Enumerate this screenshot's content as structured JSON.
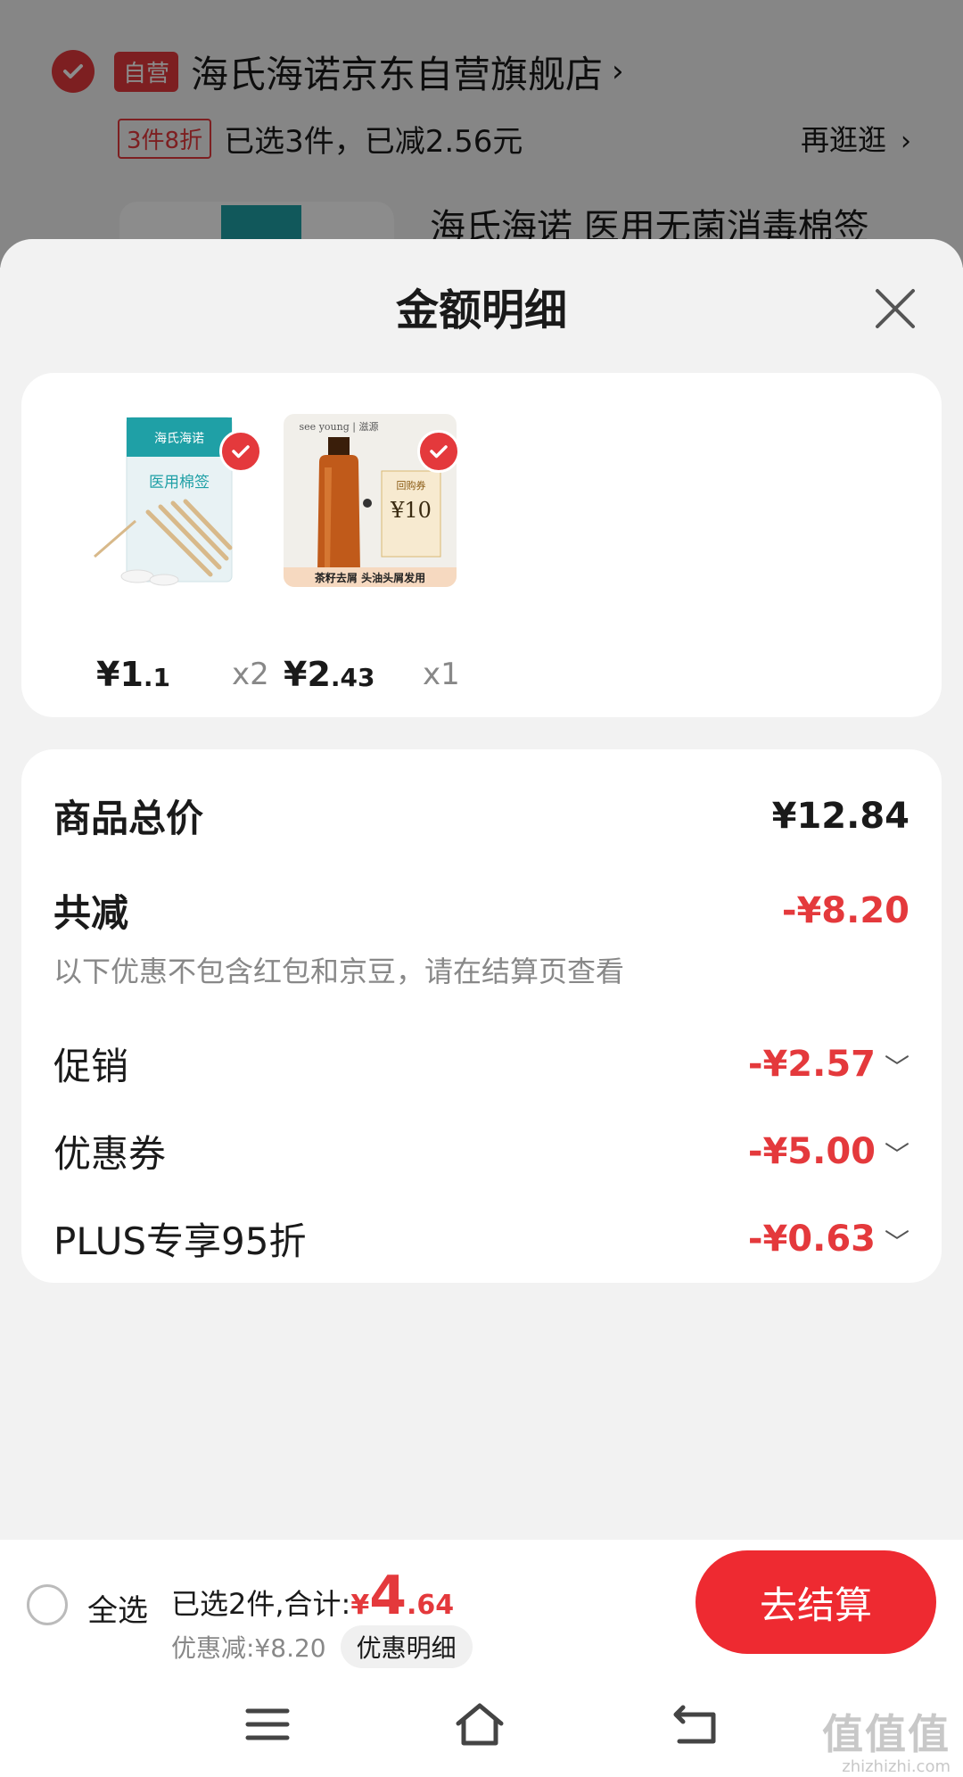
{
  "background_cart": {
    "self_tag": "自营",
    "store_name": "海氏海诺京东自营旗舰店",
    "store_chevron": "›",
    "promo_tag": "3件8折",
    "promo_text": "已选3件，已减2.56元",
    "browse_label": "再逛逛",
    "browse_chevron": "›",
    "product_title": "海氏海诺 医用无菌消毒棉签"
  },
  "sheet": {
    "title": "金额明细",
    "close_icon": "close-icon"
  },
  "products": [
    {
      "price_int": "¥1",
      "price_dec": ".1",
      "qty": "x2",
      "image": "cotton-swab-package"
    },
    {
      "price_int": "¥2",
      "price_dec": ".43",
      "qty": "x1",
      "image": "shampoo-bottle-coupon"
    }
  ],
  "product_images": {
    "p1_brand": "海氏海诺",
    "p1_label": "医用棉签",
    "p2_brand": "see young | 滋源",
    "p2_coupon_label": "回购券",
    "p2_coupon_value": "¥10",
    "p2_caption": "茶籽去屑  头油头屑发用"
  },
  "summary": {
    "goods_total_label": "商品总价",
    "goods_total_value": "¥12.84",
    "total_discount_label": "共减",
    "total_discount_value": "-¥8.20",
    "note": "以下优惠不包含红包和京豆，请在结算页查看",
    "items": [
      {
        "label": "促销",
        "value": "-¥2.57"
      },
      {
        "label": "优惠券",
        "value": "-¥5.00"
      },
      {
        "label": "PLUS专享95折",
        "value": "-¥0.63"
      }
    ],
    "chevron": "﹀"
  },
  "checkout": {
    "select_all": "全选",
    "selected_text": "已选2件,合计:",
    "total_yen": "¥",
    "total_int": "4",
    "total_dec": ".64",
    "discount_text": "优惠减:¥8.20",
    "detail_button": "优惠明细",
    "pay_button": "去结算"
  },
  "watermark": {
    "glyphs": "值值值",
    "url": "zhizhizhi.com"
  },
  "colors": {
    "accent_red": "#e4393c",
    "pay_button": "#ee2a31",
    "background": "#f2f2f2"
  }
}
